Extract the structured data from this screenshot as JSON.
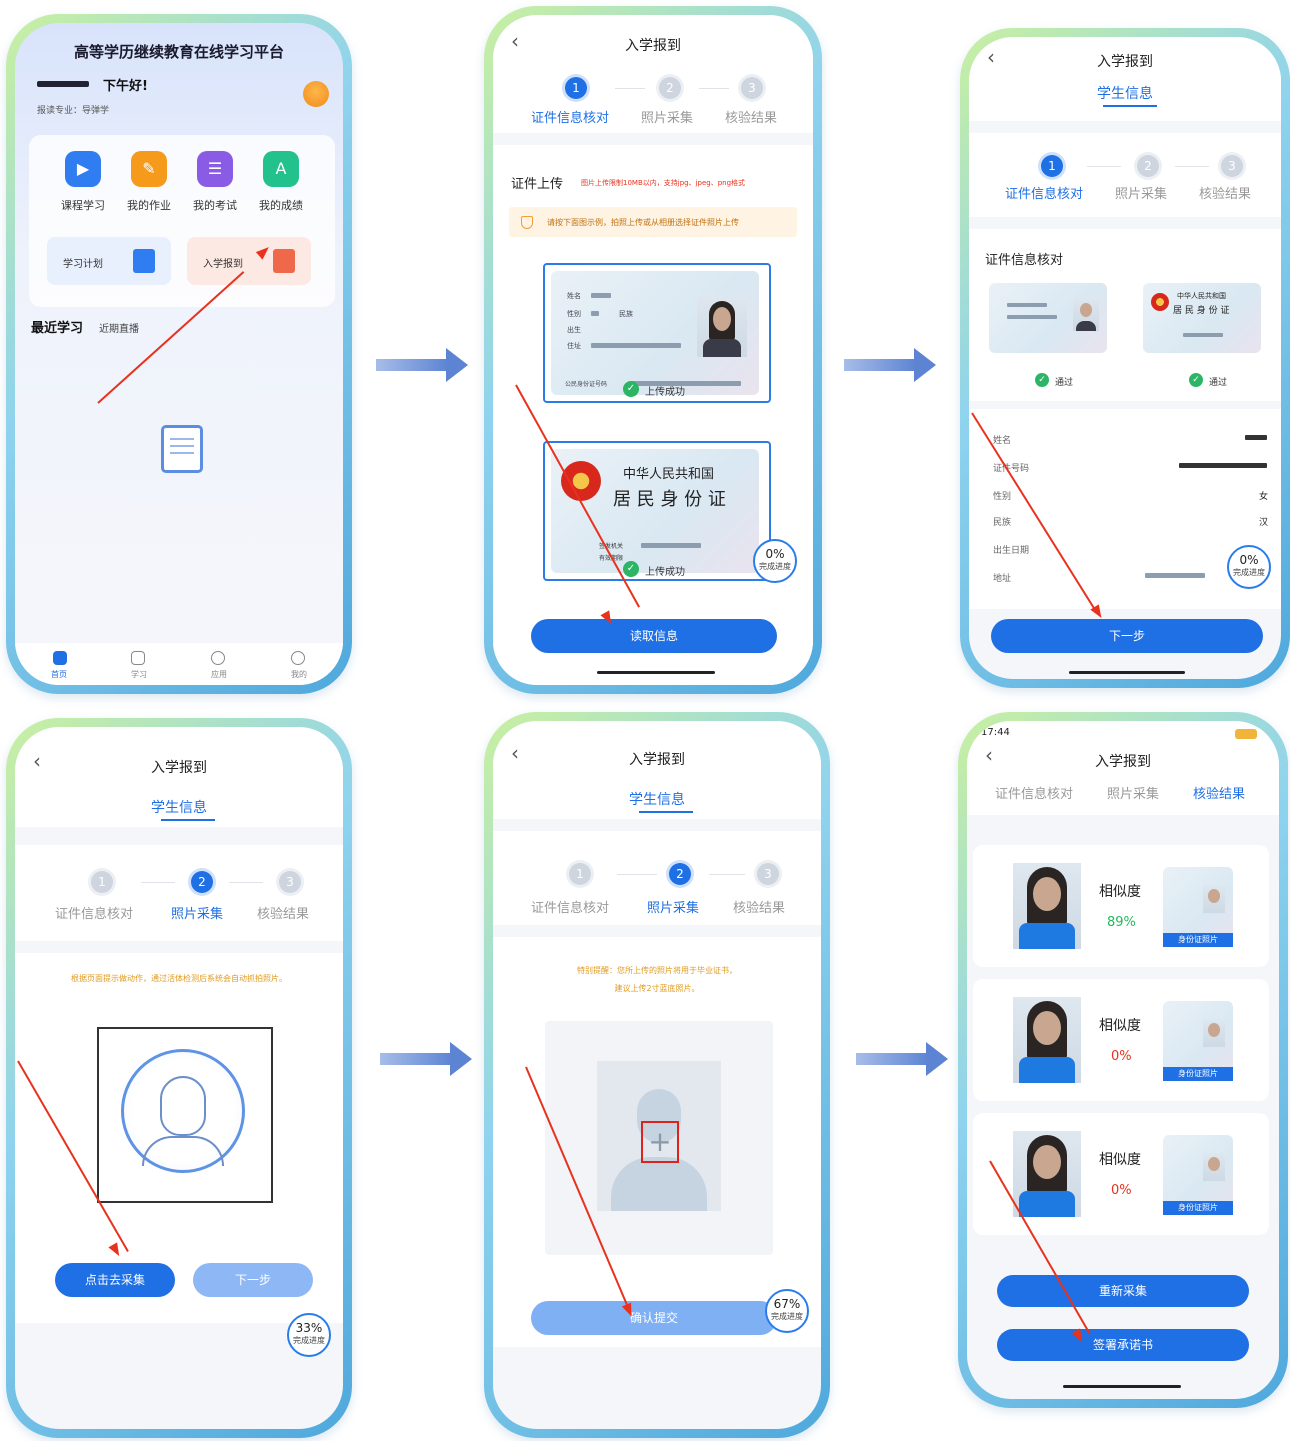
{
  "p1": {
    "title": "高等学历继续教育在线学习平台",
    "greeting": "下午好!",
    "major": "报读专业：导弹学",
    "grid": [
      {
        "label": "课程学习",
        "icon": "play-icon",
        "color": "#2f7df0"
      },
      {
        "label": "我的作业",
        "icon": "homework-icon",
        "color": "#f59a1b"
      },
      {
        "label": "我的考试",
        "icon": "exam-icon",
        "color": "#8a5ce6"
      },
      {
        "label": "我的成绩",
        "icon": "score-icon",
        "color": "#23c28d"
      }
    ],
    "card_plan": "学习计划",
    "card_enroll": "入学报到",
    "recent": "最近学习",
    "live": "近期直播",
    "nav": [
      {
        "label": "首页",
        "icon": "home-icon"
      },
      {
        "label": "学习",
        "icon": "play-icon"
      },
      {
        "label": "应用",
        "icon": "apps-icon"
      },
      {
        "label": "我的",
        "icon": "user-icon"
      }
    ]
  },
  "steps": [
    "证件信息核对",
    "照片采集",
    "核验结果"
  ],
  "p2": {
    "title": "入学报到",
    "upload": "证件上传",
    "limit": "图片上传限制10MB以内，支持jpg、jpeg、png格式",
    "tip": "请按下面图示例，拍照上传或从相册选择证件照片上传",
    "front": {
      "name": "姓名",
      "gender": "性别",
      "ethnic": "民族",
      "birth": "出生",
      "addr": "住址",
      "idno": "公民身份证号码",
      "ok": "上传成功"
    },
    "back": {
      "line1": "中华人民共和国",
      "line2": "居 民 身 份 证",
      "auth": "签发机关",
      "valid": "有效期限",
      "ok": "上传成功"
    },
    "pct": "0%",
    "pct_label": "完成进度",
    "btn": "读取信息"
  },
  "p3": {
    "title": "入学报到",
    "tab": "学生信息",
    "section": "证件信息核对",
    "pass": "通过",
    "back_line1": "中华人民共和国",
    "back_line2": "居 民 身 份 证",
    "fields": [
      {
        "label": "姓名",
        "value": ""
      },
      {
        "label": "证件号码",
        "value": ""
      },
      {
        "label": "性别",
        "value": "女"
      },
      {
        "label": "民族",
        "value": "汉"
      },
      {
        "label": "出生日期",
        "value": ""
      },
      {
        "label": "地址",
        "value": ""
      }
    ],
    "pct": "0%",
    "pct_label": "完成进度",
    "btn": "下一步"
  },
  "p4": {
    "title": "入学报到",
    "tab": "学生信息",
    "hint": "根据页面提示做动作，通过活体检测后系统会自动抓拍照片。",
    "btn_collect": "点击去采集",
    "btn_next": "下一步",
    "pct": "33%",
    "pct_label": "完成进度"
  },
  "p5": {
    "title": "入学报到",
    "tab": "学生信息",
    "notice1": "特别提醒：您所上传的照片将用于毕业证书，",
    "notice2": "建议上传2寸蓝底照片。",
    "btn": "确认提交",
    "pct": "67%",
    "pct_label": "完成进度"
  },
  "p6": {
    "time": "17:44",
    "title": "入学报到",
    "similar": "相似度",
    "idphoto": "身份证照片",
    "results": [
      {
        "value": "89%",
        "color": "#23b85a"
      },
      {
        "value": "0%",
        "color": "#e8321e"
      },
      {
        "value": "0%",
        "color": "#e8321e"
      }
    ],
    "btn_retake": "重新采集",
    "btn_sign": "签署承诺书"
  }
}
